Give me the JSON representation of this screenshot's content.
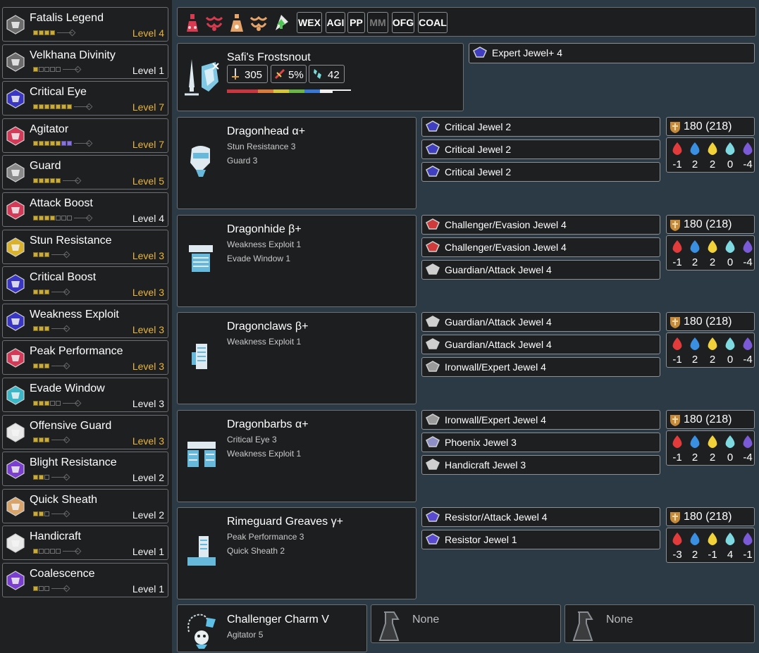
{
  "skills": [
    {
      "name": "Fatalis Legend",
      "level": "Level 4",
      "maxed": true,
      "pips": [
        "on",
        "on",
        "on",
        "on"
      ],
      "color": "#6c6c6c"
    },
    {
      "name": "Velkhana Divinity",
      "level": "Level 1",
      "maxed": false,
      "pips": [
        "on",
        "off",
        "off",
        "off",
        "off"
      ],
      "color": "#6c6c6c"
    },
    {
      "name": "Critical Eye",
      "level": "Level 7",
      "maxed": true,
      "pips": [
        "on",
        "on",
        "on",
        "on",
        "on",
        "on",
        "on"
      ],
      "color": "#3a36c4"
    },
    {
      "name": "Agitator",
      "level": "Level 7",
      "maxed": true,
      "pips": [
        "on",
        "on",
        "on",
        "on",
        "on",
        "bonus",
        "bonus"
      ],
      "color": "#d23a57"
    },
    {
      "name": "Guard",
      "level": "Level 5",
      "maxed": true,
      "pips": [
        "on",
        "on",
        "on",
        "on",
        "on"
      ],
      "color": "#8a8a8a"
    },
    {
      "name": "Attack Boost",
      "level": "Level 4",
      "maxed": false,
      "pips": [
        "on",
        "on",
        "on",
        "on",
        "off",
        "off",
        "off"
      ],
      "color": "#d23a57"
    },
    {
      "name": "Stun Resistance",
      "level": "Level 3",
      "maxed": true,
      "pips": [
        "on",
        "on",
        "on"
      ],
      "color": "#d9b12a"
    },
    {
      "name": "Critical Boost",
      "level": "Level 3",
      "maxed": true,
      "pips": [
        "on",
        "on",
        "on"
      ],
      "color": "#3a36c4"
    },
    {
      "name": "Weakness Exploit",
      "level": "Level 3",
      "maxed": true,
      "pips": [
        "on",
        "on",
        "on"
      ],
      "color": "#3a36c4"
    },
    {
      "name": "Peak Performance",
      "level": "Level 3",
      "maxed": true,
      "pips": [
        "on",
        "on",
        "on"
      ],
      "color": "#d23a57"
    },
    {
      "name": "Evade Window",
      "level": "Level 3",
      "maxed": false,
      "pips": [
        "on",
        "on",
        "on",
        "off",
        "off"
      ],
      "color": "#3bb7c7"
    },
    {
      "name": "Offensive Guard",
      "level": "Level 3",
      "maxed": true,
      "pips": [
        "on",
        "on",
        "on"
      ],
      "color": "#e8e8e8"
    },
    {
      "name": "Blight Resistance",
      "level": "Level 2",
      "maxed": false,
      "pips": [
        "on",
        "on",
        "off"
      ],
      "color": "#7a3fcf"
    },
    {
      "name": "Quick Sheath",
      "level": "Level 2",
      "maxed": false,
      "pips": [
        "on",
        "on",
        "off"
      ],
      "color": "#d9a46a"
    },
    {
      "name": "Handicraft",
      "level": "Level 1",
      "maxed": false,
      "pips": [
        "on",
        "off",
        "off",
        "off",
        "off"
      ],
      "color": "#e8e8e8"
    },
    {
      "name": "Coalescence",
      "level": "Level 1",
      "maxed": false,
      "pips": [
        "on",
        "off",
        "off"
      ],
      "color": "#7a3fcf"
    }
  ],
  "filters": {
    "icons": [
      "hp-potion-icon",
      "demon-powder-icon",
      "armor-powder-icon",
      "might-seed-icon",
      "ration-icon"
    ],
    "buttons": [
      {
        "label": "WEX",
        "active": true
      },
      {
        "label": "AGI",
        "active": true
      },
      {
        "label": "PP",
        "active": true
      },
      {
        "label": "MM",
        "active": false
      },
      {
        "label": "OFG",
        "active": true
      },
      {
        "label": "COAL",
        "active": true
      }
    ]
  },
  "weapon": {
    "name": "Safi's Frostsnout",
    "attack": "305",
    "affinity": "5%",
    "element": "42",
    "deco": "Expert Jewel+ 4",
    "sharpness_colors": [
      "#c8363f",
      "#d97b3a",
      "#d6c63a",
      "#6cb648",
      "#3a78d6",
      "#f0f0f0",
      "#f0f0f0"
    ]
  },
  "armor": [
    {
      "name": "Dragonhead α+",
      "skills": [
        "Stun Resistance 3",
        "Guard 3"
      ],
      "decos": [
        {
          "label": "Critical Jewel 2",
          "color": "#3f3fbf"
        },
        {
          "label": "Critical Jewel 2",
          "color": "#3f3fbf"
        },
        {
          "label": "Critical Jewel 2",
          "color": "#3f3fbf"
        }
      ],
      "defense": "180  (218)",
      "res": [
        "-1",
        "2",
        "2",
        "0",
        "-4"
      ]
    },
    {
      "name": "Dragonhide β+",
      "skills": [
        "Weakness Exploit 1",
        "Evade Window 1"
      ],
      "decos": [
        {
          "label": "Challenger/Evasion Jewel 4",
          "color": "#cf3a3a"
        },
        {
          "label": "Challenger/Evasion Jewel 4",
          "color": "#cf3a3a"
        },
        {
          "label": "Guardian/Attack Jewel 4",
          "color": "#cfcfcf"
        }
      ],
      "defense": "180  (218)",
      "res": [
        "-1",
        "2",
        "2",
        "0",
        "-4"
      ]
    },
    {
      "name": "Dragonclaws β+",
      "skills": [
        "Weakness Exploit 1"
      ],
      "decos": [
        {
          "label": "Guardian/Attack Jewel 4",
          "color": "#cfcfcf"
        },
        {
          "label": "Guardian/Attack Jewel 4",
          "color": "#cfcfcf"
        },
        {
          "label": "Ironwall/Expert Jewel 4",
          "color": "#9a9a9a"
        }
      ],
      "defense": "180  (218)",
      "res": [
        "-1",
        "2",
        "2",
        "0",
        "-4"
      ]
    },
    {
      "name": "Dragonbarbs α+",
      "skills": [
        "Critical Eye 3",
        "Weakness Exploit 1"
      ],
      "decos": [
        {
          "label": "Ironwall/Expert Jewel 4",
          "color": "#9a9a9a"
        },
        {
          "label": "Phoenix Jewel 3",
          "color": "#8f8fc7"
        },
        {
          "label": "Handicraft Jewel 3",
          "color": "#cfcfcf"
        }
      ],
      "defense": "180  (218)",
      "res": [
        "-1",
        "2",
        "2",
        "0",
        "-4"
      ]
    },
    {
      "name": "Rimeguard Greaves γ+",
      "skills": [
        "Peak Performance 3",
        "Quick Sheath 2"
      ],
      "decos": [
        {
          "label": "Resistor/Attack Jewel 4",
          "color": "#5a4ad0"
        },
        {
          "label": "Resistor Jewel 1",
          "color": "#5a4ad0"
        }
      ],
      "defense": "180  (218)",
      "res": [
        "-3",
        "2",
        "-1",
        "4",
        "-1"
      ]
    }
  ],
  "charm": {
    "name": "Challenger Charm V",
    "skill": "Agitator 5"
  },
  "empty_slots": [
    "None",
    "None"
  ]
}
